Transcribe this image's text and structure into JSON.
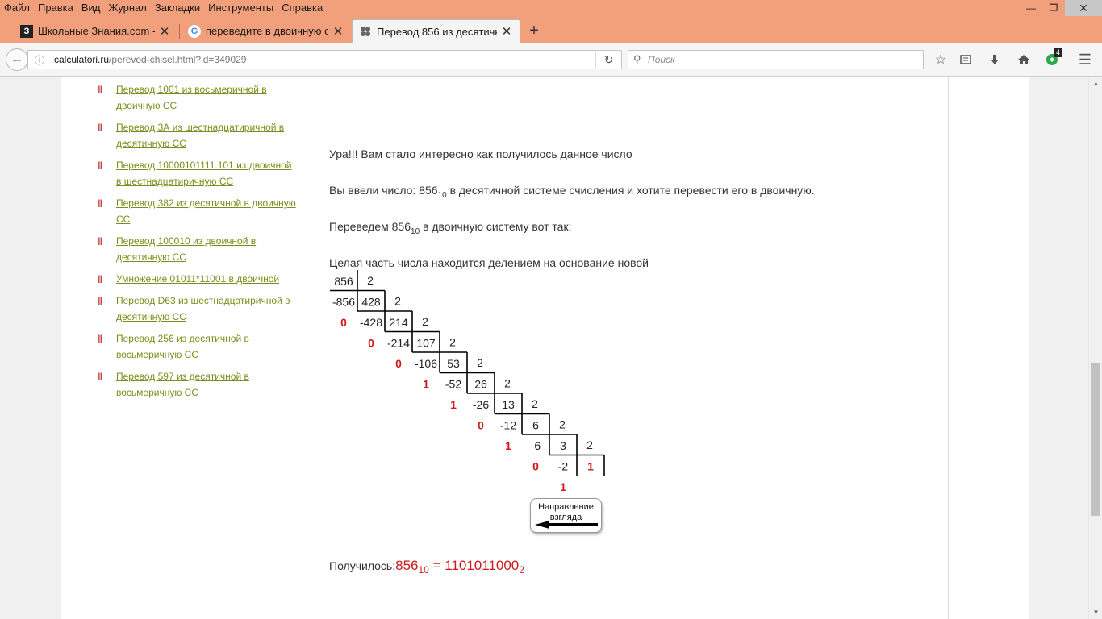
{
  "menu": [
    "Файл",
    "Правка",
    "Вид",
    "Журнал",
    "Закладки",
    "Инструменты",
    "Справка"
  ],
  "window_controls": {
    "minimize": "—",
    "restore": "❐",
    "close": "✕"
  },
  "tabs": [
    {
      "title": "Школьные Знания.com -...",
      "favicon": "З",
      "active": false
    },
    {
      "title": "переведите в двоичную с...",
      "favicon": "G",
      "active": false
    },
    {
      "title": "Перевод 856 из десятичн...",
      "favicon": "calc",
      "active": true
    }
  ],
  "new_tab": "+",
  "url": {
    "host": "calculatori.ru",
    "path": "/perevod-chisel.html?id=349029"
  },
  "search": {
    "placeholder": "Поиск"
  },
  "extension_badge": "4",
  "sidebar_links": [
    "Перевод 1001 из восьмеричной в двоичную СС",
    "Перевод 3А из шестнадцатиричной в десятичную СС",
    "Перевод 10000101111.101 из двоичной в шестнадцатиричную СС",
    "Перевод 382 из десятичной в двоичную СС",
    "Перевод 100010 из двоичной в десятичную СС",
    "Умножение 01011*11001 в двоичной",
    "Перевод D63 из шестнадцатиричной в десятичную СС",
    "Перевод 256 из десятичной в восьмеричную СС",
    "Перевод 597 из десятичной в восьмеричную СС"
  ],
  "content": {
    "hooray": "Ура!!! Вам стало интересно как получилось данное число",
    "entered_prefix": "Вы ввели число: 856",
    "entered_base": "10",
    "entered_suffix": " в десятичной системе счисления и хотите перевести его в двоичную.",
    "translate_prefix": "Переведем 856",
    "translate_base": "10",
    "translate_suffix": " в двоичную систему вот так:",
    "integer_part": "Целая часть числа находится делением на основание новой",
    "divisor": "2",
    "steps": [
      {
        "dividend": "856",
        "subtract": "-856",
        "remainder": "0"
      },
      {
        "dividend": "428",
        "subtract": "-428",
        "remainder": "0"
      },
      {
        "dividend": "214",
        "subtract": "-214",
        "remainder": "0"
      },
      {
        "dividend": "107",
        "subtract": "-106",
        "remainder": "1"
      },
      {
        "dividend": "53",
        "subtract": "-52",
        "remainder": "1"
      },
      {
        "dividend": "26",
        "subtract": "-26",
        "remainder": "0"
      },
      {
        "dividend": "13",
        "subtract": "-12",
        "remainder": "1"
      },
      {
        "dividend": "6",
        "subtract": "-6",
        "remainder": "0"
      },
      {
        "dividend": "3",
        "subtract": "-2",
        "remainder": "1"
      }
    ],
    "final_quotient": "1",
    "direction_label": "Направление взгляда",
    "result_label": "Получилось:",
    "result_value": "856",
    "result_from_base": "10",
    "result_equals": " = 1101011000",
    "result_to_base": "2"
  },
  "colors": {
    "chrome": "#f29f7c",
    "link": "#7d8c1c",
    "bullet": "#b02020",
    "remainder": "#d0191b"
  }
}
